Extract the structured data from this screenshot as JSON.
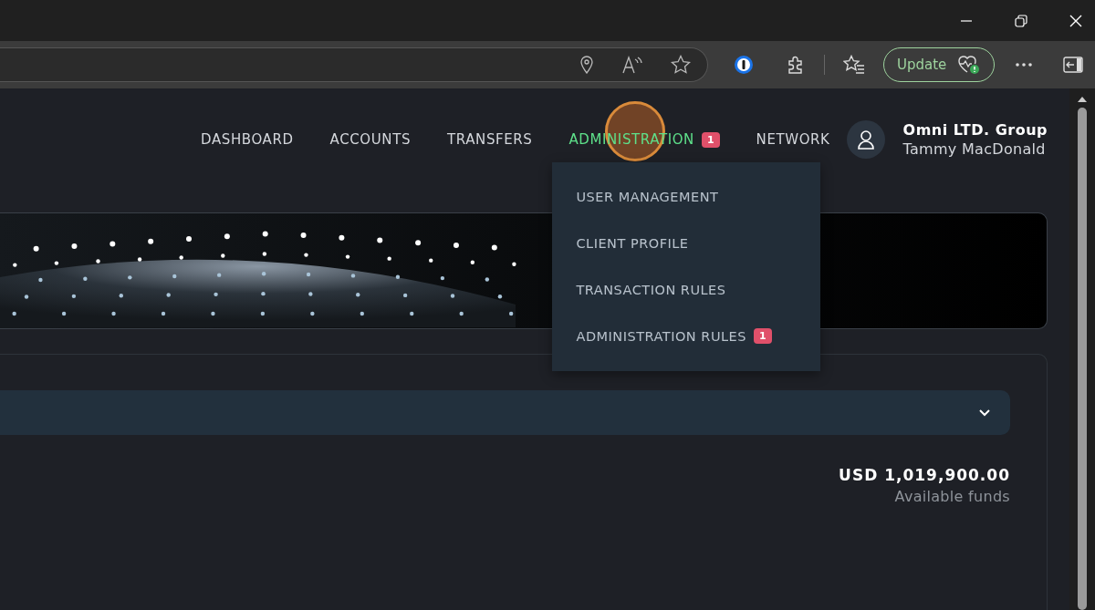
{
  "browser": {
    "update_button": {
      "label": "Update"
    }
  },
  "nav": {
    "items": [
      {
        "label": "DASHBOARD",
        "selected": false
      },
      {
        "label": "ACCOUNTS",
        "selected": false
      },
      {
        "label": "TRANSFERS",
        "selected": false
      },
      {
        "label": "ADMINISTRATION",
        "selected": true,
        "badge": "1",
        "expanded": true,
        "menu": [
          {
            "label": "USER MANAGEMENT"
          },
          {
            "label": "CLIENT PROFILE"
          },
          {
            "label": "TRANSACTION RULES"
          },
          {
            "label": "ADMINISTRATION RULES",
            "badge": "1"
          }
        ]
      },
      {
        "label": "NETWORK",
        "selected": false
      }
    ]
  },
  "user": {
    "company": "Omni LTD. Group",
    "name": "Tammy MacDonald"
  },
  "balance": {
    "amount": "USD 1,019,900.00",
    "label": "Available funds"
  }
}
